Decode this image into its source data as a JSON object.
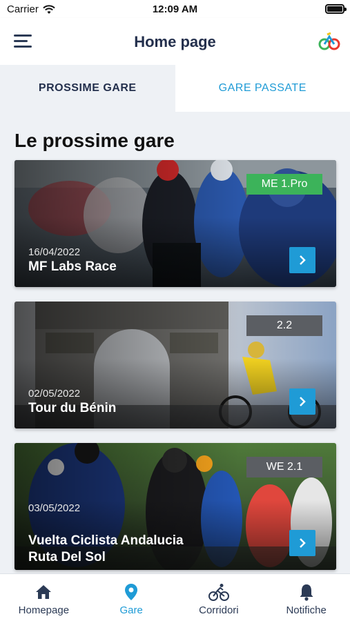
{
  "status": {
    "carrier": "Carrier",
    "time": "12:09 AM"
  },
  "header": {
    "title": "Home page"
  },
  "tabs": [
    {
      "label": "PROSSIME GARE",
      "active": true
    },
    {
      "label": "GARE PASSATE",
      "active": false
    }
  ],
  "section": {
    "title": "Le prossime gare"
  },
  "races": [
    {
      "badge": "ME 1.Pro",
      "badge_color": "#3cb35a",
      "date": "16/04/2022",
      "name": "MF Labs Race"
    },
    {
      "badge": "2.2",
      "badge_color": "#5b5e63",
      "date": "02/05/2022",
      "name": "Tour du Bénin"
    },
    {
      "badge": "WE 2.1",
      "badge_color": "#5b5e63",
      "date": "03/05/2022",
      "name_line1": "Vuelta Ciclista Andalucia",
      "name_line2": "Ruta Del Sol"
    }
  ],
  "tabbar": [
    {
      "label": "Homepage",
      "icon": "home-icon",
      "active": false
    },
    {
      "label": "Gare",
      "icon": "location-pin-icon",
      "active": true
    },
    {
      "label": "Corridori",
      "icon": "bicycle-rider-icon",
      "active": false
    },
    {
      "label": "Notifiche",
      "icon": "bell-icon",
      "active": false
    }
  ],
  "colors": {
    "accent": "#1f9bd6",
    "navy": "#24304d",
    "green_badge": "#3cb35a",
    "grey_badge": "#5b5e63"
  }
}
